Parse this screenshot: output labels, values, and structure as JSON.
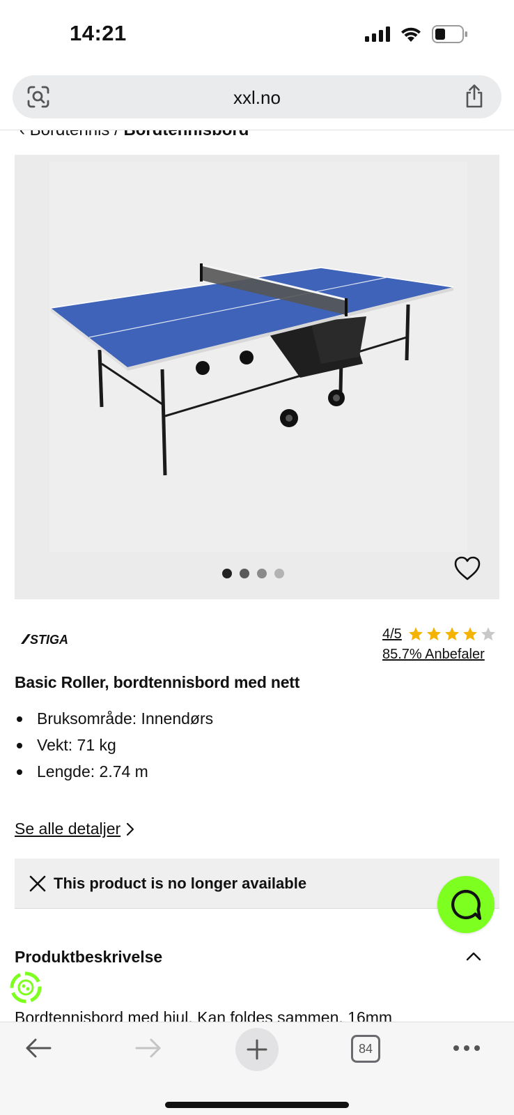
{
  "status_bar": {
    "time": "14:21"
  },
  "browser": {
    "url": "xxl.no",
    "tab_count": "84"
  },
  "breadcrumb": {
    "parent": "Bordtennis",
    "separator": "/",
    "current": "Bordtennisbord"
  },
  "gallery": {
    "image_count": 4,
    "active_index": 0,
    "dot_colors": [
      "#222222",
      "#5a5a5a",
      "#8a8a8a",
      "#b3b3b3"
    ]
  },
  "product": {
    "brand": "STIGA",
    "rating": "4/5",
    "rating_stars": 4,
    "rating_max": 5,
    "recommend": "85.7% Anbefaler",
    "title": "Basic Roller, bordtennisbord med nett",
    "specs": [
      "Bruksområde: Innendørs",
      "Vekt: 71 kg",
      "Lengde: 2.74 m"
    ],
    "details_link": "Se alle detaljer",
    "unavailable_notice": "This product is no longer available"
  },
  "description": {
    "heading": "Produktbeskrivelse",
    "text": "Bordtennisbord med hjul. Kan foldes sammen. 16mm"
  },
  "colors": {
    "accent_green": "#7dff1f",
    "star": "#f5b301",
    "star_empty": "#c8c8c8",
    "table_blue": "#3f63b8"
  },
  "icons": {
    "lens": "lens-icon",
    "share": "share-icon",
    "heart": "heart-icon",
    "chat": "chat-icon",
    "back": "back-arrow-icon",
    "forward": "forward-arrow-icon",
    "plus": "plus-icon",
    "more": "more-icon"
  }
}
